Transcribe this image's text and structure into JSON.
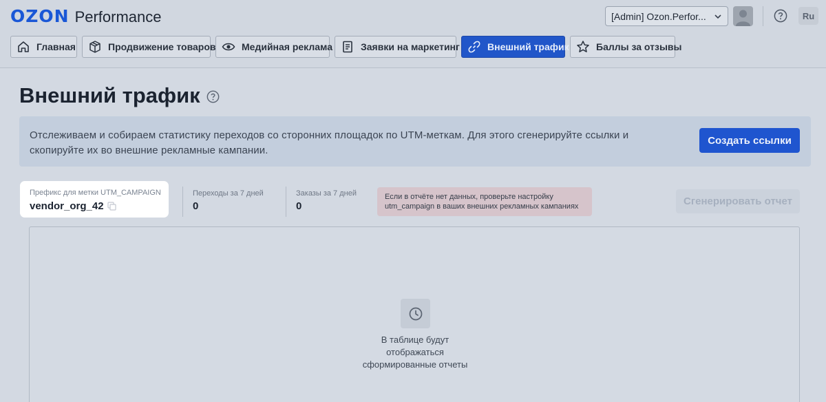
{
  "header": {
    "logo_brand": "OZON",
    "logo_product": "Performance",
    "account_label": "[Admin] Ozon.Perfor...",
    "language": "Ru"
  },
  "nav": {
    "tabs": [
      {
        "label": "Главная",
        "icon": "home-icon"
      },
      {
        "label": "Продвижение товаров",
        "icon": "box-icon"
      },
      {
        "label": "Медийная реклама",
        "icon": "eye-icon"
      },
      {
        "label": "Заявки на маркетинг",
        "icon": "document-icon"
      },
      {
        "label": "Внешний трафик",
        "icon": "link-icon",
        "active": true
      },
      {
        "label": "Баллы за отзывы",
        "icon": "star-icon"
      }
    ]
  },
  "page": {
    "title": "Внешний трафик",
    "banner_text": "Отслеживаем и собираем статистику переходов со сторонних площадок по UTM-меткам. Для этого сгенерируйте ссылки и скопируйте их во внешние рекламные кампании.",
    "create_links_label": "Создать ссылки"
  },
  "stats": {
    "prefix_label": "Префикс для метки UTM_CAMPAIGN",
    "prefix_value": "vendor_org_42",
    "visits_label": "Переходы за 7 дней",
    "visits_value": "0",
    "orders_label": "Заказы за 7 дней",
    "orders_value": "0",
    "warning_line1": "Если в отчёте нет данных, проверьте настройку",
    "warning_line2": "utm_campaign в ваших внешних рекламных кампаниях",
    "generate_label": "Сгенерировать отчет"
  },
  "table": {
    "empty_line1": "В таблице будут",
    "empty_line2": "отображаться",
    "empty_line3": "сформированные отчеты",
    "empty_icon": "clock-icon"
  },
  "colors": {
    "brand_blue": "#1a57d6",
    "primary_button": "#1f55cf",
    "active_tab": "#2156c9"
  }
}
